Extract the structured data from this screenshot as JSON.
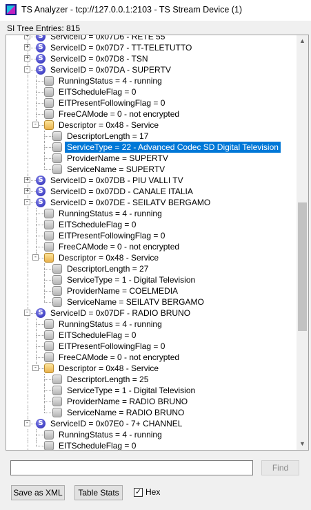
{
  "window": {
    "title": "TS Analyzer - tcp://127.0.0.1:2103 - TS Stream Device (1)"
  },
  "tree": {
    "header": "SI Tree Entries: 815",
    "rows": [
      {
        "depth": 0,
        "exp": "+",
        "icon": "s",
        "text": "ServiceID = 0x07D6 - RETE 55"
      },
      {
        "depth": 0,
        "exp": "+",
        "icon": "s",
        "text": "ServiceID = 0x07D7 - TT-TELETUTTO"
      },
      {
        "depth": 0,
        "exp": "+",
        "icon": "s",
        "text": "ServiceID = 0x07D8 - TSN"
      },
      {
        "depth": 0,
        "exp": "-",
        "icon": "s",
        "text": "ServiceID = 0x07DA - SUPERTV"
      },
      {
        "depth": 1,
        "exp": "",
        "icon": "g",
        "text": "RunningStatus = 4 - running"
      },
      {
        "depth": 1,
        "exp": "",
        "icon": "g",
        "text": "EITScheduleFlag = 0"
      },
      {
        "depth": 1,
        "exp": "",
        "icon": "g",
        "text": "EITPresentFollowingFlag = 0"
      },
      {
        "depth": 1,
        "exp": "",
        "icon": "g",
        "text": "FreeCAMode = 0 - not encrypted"
      },
      {
        "depth": 1,
        "exp": "-",
        "icon": "f",
        "text": "Descriptor = 0x48 - Service"
      },
      {
        "depth": 2,
        "exp": "",
        "icon": "g",
        "text": "DescriptorLength = 17"
      },
      {
        "depth": 2,
        "exp": "",
        "icon": "g",
        "text": "ServiceType = 22 - Advanced Codec SD Digital Television",
        "selected": true
      },
      {
        "depth": 2,
        "exp": "",
        "icon": "g",
        "text": "ProviderName = SUPERTV"
      },
      {
        "depth": 2,
        "exp": "",
        "icon": "g",
        "text": "ServiceName = SUPERTV"
      },
      {
        "depth": 0,
        "exp": "+",
        "icon": "s",
        "text": "ServiceID = 0x07DB - PIU VALLI TV"
      },
      {
        "depth": 0,
        "exp": "+",
        "icon": "s",
        "text": "ServiceID = 0x07DD - CANALE ITALIA"
      },
      {
        "depth": 0,
        "exp": "-",
        "icon": "s",
        "text": "ServiceID = 0x07DE - SEILATV BERGAMO"
      },
      {
        "depth": 1,
        "exp": "",
        "icon": "g",
        "text": "RunningStatus = 4 - running"
      },
      {
        "depth": 1,
        "exp": "",
        "icon": "g",
        "text": "EITScheduleFlag = 0"
      },
      {
        "depth": 1,
        "exp": "",
        "icon": "g",
        "text": "EITPresentFollowingFlag = 0"
      },
      {
        "depth": 1,
        "exp": "",
        "icon": "g",
        "text": "FreeCAMode = 0 - not encrypted"
      },
      {
        "depth": 1,
        "exp": "-",
        "icon": "f",
        "text": "Descriptor = 0x48 - Service"
      },
      {
        "depth": 2,
        "exp": "",
        "icon": "g",
        "text": "DescriptorLength = 27"
      },
      {
        "depth": 2,
        "exp": "",
        "icon": "g",
        "text": "ServiceType = 1 - Digital Television"
      },
      {
        "depth": 2,
        "exp": "",
        "icon": "g",
        "text": "ProviderName = COELMEDIA"
      },
      {
        "depth": 2,
        "exp": "",
        "icon": "g",
        "text": "ServiceName = SEILATV BERGAMO"
      },
      {
        "depth": 0,
        "exp": "-",
        "icon": "s",
        "text": "ServiceID = 0x07DF - RADIO BRUNO"
      },
      {
        "depth": 1,
        "exp": "",
        "icon": "g",
        "text": "RunningStatus = 4 - running"
      },
      {
        "depth": 1,
        "exp": "",
        "icon": "g",
        "text": "EITScheduleFlag = 0"
      },
      {
        "depth": 1,
        "exp": "",
        "icon": "g",
        "text": "EITPresentFollowingFlag = 0"
      },
      {
        "depth": 1,
        "exp": "",
        "icon": "g",
        "text": "FreeCAMode = 0 - not encrypted"
      },
      {
        "depth": 1,
        "exp": "-",
        "icon": "f",
        "text": "Descriptor = 0x48 - Service"
      },
      {
        "depth": 2,
        "exp": "",
        "icon": "g",
        "text": "DescriptorLength = 25"
      },
      {
        "depth": 2,
        "exp": "",
        "icon": "g",
        "text": "ServiceType = 1 - Digital Television"
      },
      {
        "depth": 2,
        "exp": "",
        "icon": "g",
        "text": "ProviderName = RADIO BRUNO"
      },
      {
        "depth": 2,
        "exp": "",
        "icon": "g",
        "text": "ServiceName = RADIO BRUNO"
      },
      {
        "depth": 0,
        "exp": "-",
        "icon": "s",
        "text": "ServiceID = 0x07E0 - 7+ CHANNEL"
      },
      {
        "depth": 1,
        "exp": "",
        "icon": "g",
        "text": "RunningStatus = 4 - running"
      },
      {
        "depth": 1,
        "exp": "",
        "icon": "g",
        "text": "EITScheduleFlag = 0"
      }
    ]
  },
  "search": {
    "value": "",
    "placeholder": ""
  },
  "buttons": {
    "find": "Find",
    "save_xml": "Save as XML",
    "table_stats": "Table Stats"
  },
  "hex": {
    "label": "Hex",
    "checked": true,
    "mark": "✓"
  },
  "colors": {
    "selection": "#0078d7",
    "service_icon": "#4a4acb",
    "descriptor_icon": "#e9b24c"
  }
}
